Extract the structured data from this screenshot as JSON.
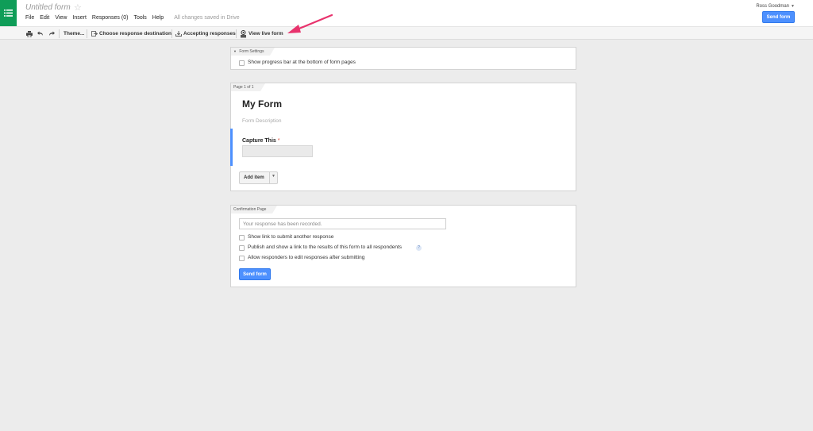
{
  "header": {
    "title": "Untitled form",
    "menu": [
      "File",
      "Edit",
      "View",
      "Insert",
      "Responses (0)",
      "Tools",
      "Help"
    ],
    "save_status": "All changes saved in Drive",
    "user": "Ross Goodman",
    "send_label": "Send form"
  },
  "toolbar": {
    "theme": "Theme...",
    "destination": "Choose response destination",
    "accepting": "Accepting responses",
    "view_live": "View live form"
  },
  "form_settings": {
    "tab": "Form Settings",
    "progress_bar": "Show progress bar at the bottom of form pages"
  },
  "page": {
    "tab": "Page 1 of 1",
    "form_title": "My Form",
    "description_placeholder": "Form Description",
    "question_title": "Capture This",
    "required_mark": "*",
    "add_item": "Add item"
  },
  "confirmation": {
    "tab": "Confirmation Page",
    "message": "Your response has been recorded.",
    "options": [
      "Show link to submit another response",
      "Publish and show a link to the results of this form to all respondents",
      "Allow responders to edit responses after submitting"
    ],
    "help": "?",
    "send_label": "Send form"
  },
  "colors": {
    "brand": "#0f9d58",
    "accent": "#4d90fe",
    "annotation": "#e8336d"
  }
}
